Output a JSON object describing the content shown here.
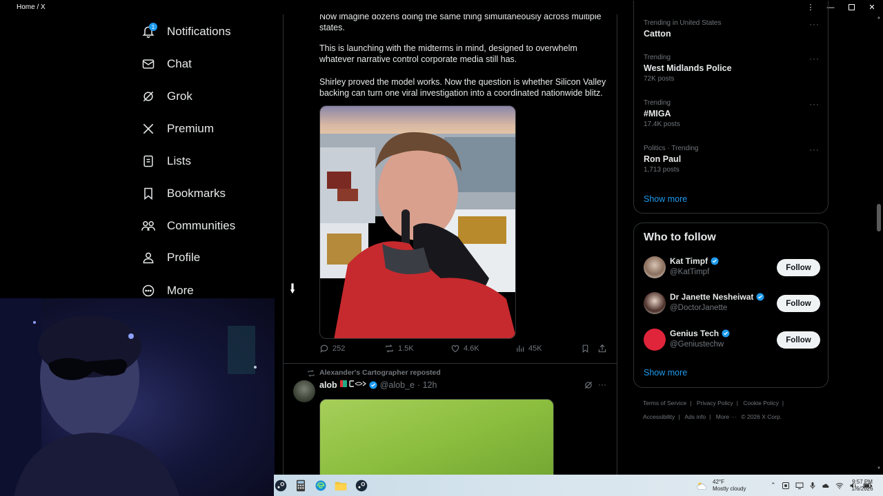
{
  "window": {
    "title": "Home / X"
  },
  "nav": {
    "notifications": {
      "label": "Notifications",
      "badge": "1"
    },
    "chat": {
      "label": "Chat"
    },
    "grok": {
      "label": "Grok"
    },
    "premium": {
      "label": "Premium"
    },
    "lists": {
      "label": "Lists"
    },
    "bookmarks": {
      "label": "Bookmarks"
    },
    "communities": {
      "label": "Communities"
    },
    "profile": {
      "label": "Profile"
    },
    "more": {
      "label": "More"
    }
  },
  "post": {
    "para1": "Now imagine dozens doing the same thing simultaneously across multiple states.",
    "para2": "This is launching with the midterms in mind, designed to overwhelm whatever narrative control corporate media still has.",
    "para3": "Shirley proved the model works. Now the question is whether Silicon Valley backing can turn one viral investigation into a coordinated nationwide blitz.",
    "replies": "252",
    "reposts": "1.5K",
    "likes": "4.6K",
    "views": "45K"
  },
  "post2": {
    "repost_label": "Alexander's Cartographer reposted",
    "name": "alob",
    "handle": "@alob_e",
    "time": "· 12h"
  },
  "trends": [
    {
      "meta": "Trending in United States",
      "name": "Catton",
      "posts": ""
    },
    {
      "meta": "Trending",
      "name": "West Midlands Police",
      "posts": "72K posts"
    },
    {
      "meta": "Trending",
      "name": "#MIGA",
      "posts": "17.4K posts"
    },
    {
      "meta": "Politics · Trending",
      "name": "Ron Paul",
      "posts": "1,713 posts"
    }
  ],
  "trends_show_more": "Show more",
  "who_to_follow": {
    "title": "Who to follow",
    "users": [
      {
        "name": "Kat Timpf",
        "handle": "@KatTimpf",
        "button": "Follow"
      },
      {
        "name": "Dr Janette Nesheiwat",
        "handle": "@DoctorJanette",
        "button": "Follow"
      },
      {
        "name": "Genius Tech",
        "handle": "@Geniustechw",
        "button": "Follow"
      }
    ],
    "show_more": "Show more"
  },
  "footer": {
    "terms": "Terms of Service",
    "privacy": "Privacy Policy",
    "cookie": "Cookie Policy",
    "accessibility": "Accessibility",
    "ads": "Ads info",
    "more": "More ···",
    "copyright": "© 2026 X Corp."
  },
  "taskbar": {
    "temp": "42°F",
    "weather": "Mostly cloudy",
    "time": "9:57 PM",
    "date": "1/6/2026"
  },
  "colors": {
    "accent": "#1d9bf0",
    "background": "#000000",
    "border": "#2f3336",
    "muted": "#71767b"
  }
}
